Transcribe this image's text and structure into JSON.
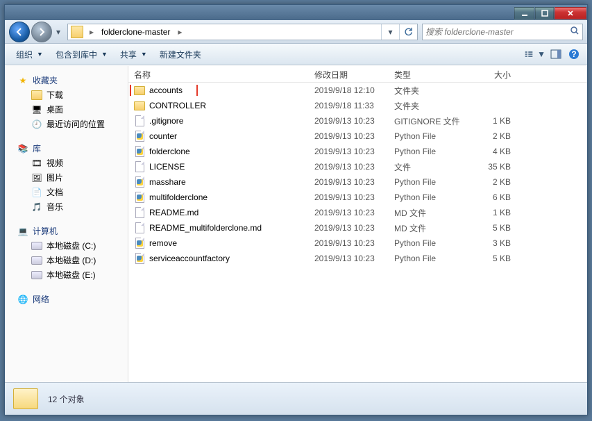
{
  "titlebar": {
    "min": "minimize",
    "max": "maximize",
    "close": "close"
  },
  "nav": {
    "path_segment": "folderclone-master",
    "search_placeholder": "搜索 folderclone-master"
  },
  "toolbar": {
    "organize": "组织",
    "include": "包含到库中",
    "share": "共享",
    "newfolder": "新建文件夹"
  },
  "sidebar": {
    "favorites": {
      "label": "收藏夹",
      "items": [
        "下载",
        "桌面",
        "最近访问的位置"
      ]
    },
    "libraries": {
      "label": "库",
      "items": [
        "视频",
        "图片",
        "文档",
        "音乐"
      ]
    },
    "computer": {
      "label": "计算机",
      "items": [
        "本地磁盘 (C:)",
        "本地磁盘 (D:)",
        "本地磁盘 (E:)"
      ]
    },
    "network": {
      "label": "网络"
    }
  },
  "columns": {
    "name": "名称",
    "date": "修改日期",
    "type": "类型",
    "size": "大小"
  },
  "files": [
    {
      "name": "accounts",
      "date": "2019/9/18 12:10",
      "type": "文件夹",
      "size": "",
      "icon": "folder",
      "highlight": true
    },
    {
      "name": "CONTROLLER",
      "date": "2019/9/18 11:33",
      "type": "文件夹",
      "size": "",
      "icon": "folder"
    },
    {
      "name": ".gitignore",
      "date": "2019/9/13 10:23",
      "type": "GITIGNORE 文件",
      "size": "1 KB",
      "icon": "file"
    },
    {
      "name": "counter",
      "date": "2019/9/13 10:23",
      "type": "Python File",
      "size": "2 KB",
      "icon": "py"
    },
    {
      "name": "folderclone",
      "date": "2019/9/13 10:23",
      "type": "Python File",
      "size": "4 KB",
      "icon": "py"
    },
    {
      "name": "LICENSE",
      "date": "2019/9/13 10:23",
      "type": "文件",
      "size": "35 KB",
      "icon": "file"
    },
    {
      "name": "masshare",
      "date": "2019/9/13 10:23",
      "type": "Python File",
      "size": "2 KB",
      "icon": "py"
    },
    {
      "name": "multifolderclone",
      "date": "2019/9/13 10:23",
      "type": "Python File",
      "size": "6 KB",
      "icon": "py"
    },
    {
      "name": "README.md",
      "date": "2019/9/13 10:23",
      "type": "MD 文件",
      "size": "1 KB",
      "icon": "file"
    },
    {
      "name": "README_multifolderclone.md",
      "date": "2019/9/13 10:23",
      "type": "MD 文件",
      "size": "5 KB",
      "icon": "file"
    },
    {
      "name": "remove",
      "date": "2019/9/13 10:23",
      "type": "Python File",
      "size": "3 KB",
      "icon": "py"
    },
    {
      "name": "serviceaccountfactory",
      "date": "2019/9/13 10:23",
      "type": "Python File",
      "size": "5 KB",
      "icon": "py"
    }
  ],
  "status": {
    "text": "12 个对象"
  }
}
